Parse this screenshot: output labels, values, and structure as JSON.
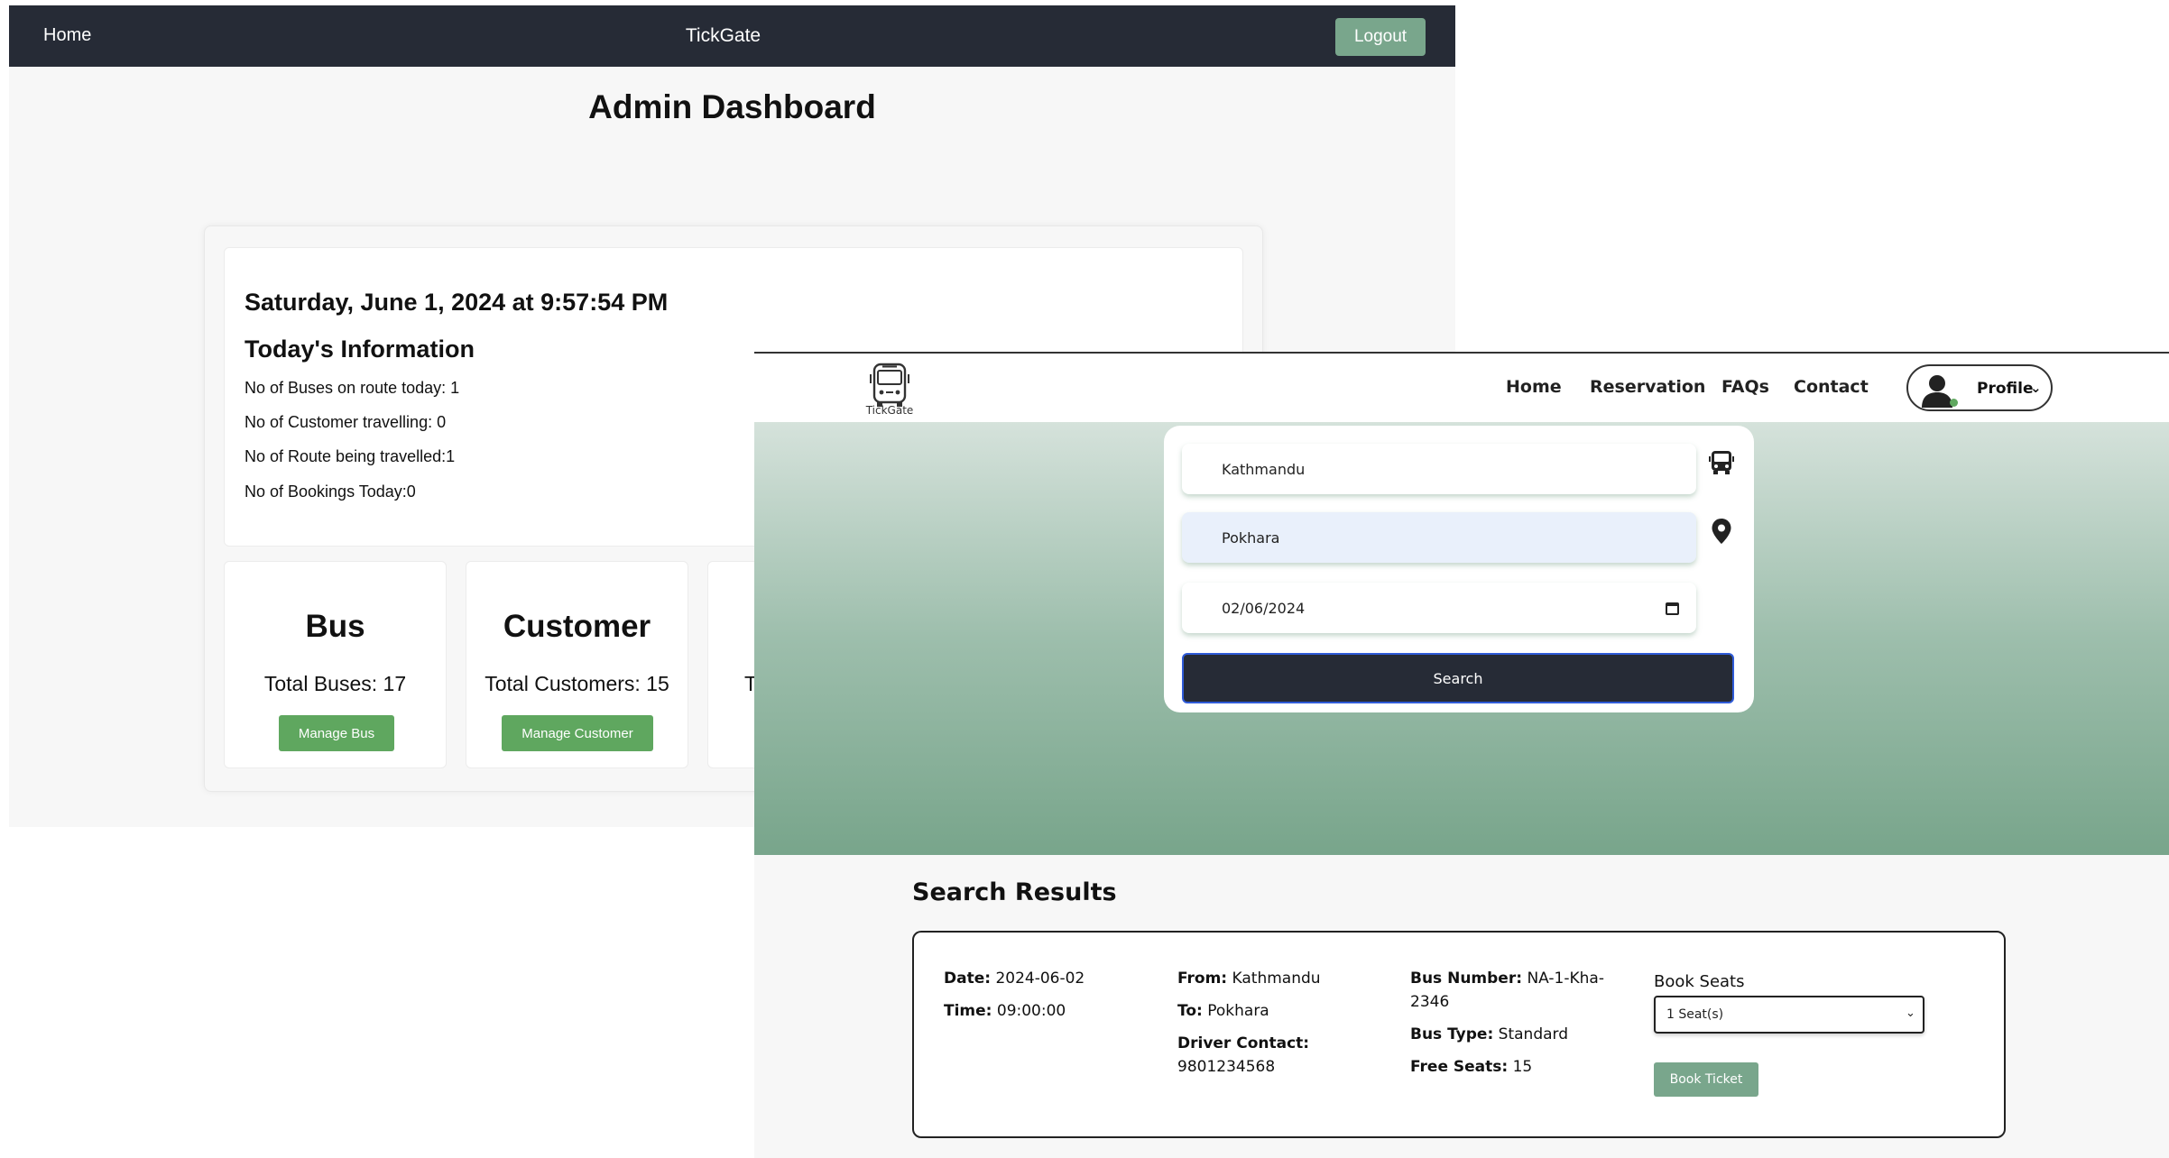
{
  "admin": {
    "nav": {
      "home": "Home",
      "brand": "TickGate",
      "logout": "Logout"
    },
    "title": "Admin Dashboard",
    "datetime": "Saturday, June 1, 2024 at 9:57:54 PM",
    "today_heading": "Today's Information",
    "stats": [
      "No of Buses on route today: 1",
      "No of Customer travelling: 0",
      "No of Route being travelled:1",
      "No of Bookings Today:0"
    ],
    "cards": [
      {
        "title": "Bus",
        "value": "Total Buses: 17",
        "button": "Manage Bus"
      },
      {
        "title": "Customer",
        "value": "Total Customers: 15",
        "button": "Manage Customer"
      },
      {
        "value_fragment": "T"
      }
    ]
  },
  "booking": {
    "logo_text": "TickGate",
    "nav": [
      "Home",
      "Reservation",
      "FAQs",
      "Contact"
    ],
    "profile_label": "Profile",
    "search": {
      "from": "Kathmandu",
      "to": "Pokhara",
      "date": "02/06/2024",
      "button": "Search"
    },
    "results_title": "Search Results",
    "result": {
      "date_label": "Date:",
      "date": "2024-06-02",
      "time_label": "Time:",
      "time": "09:00:00",
      "from_label": "From:",
      "from": "Kathmandu",
      "to_label": "To:",
      "to": "Pokhara",
      "driver_label": "Driver Contact:",
      "driver": "9801234568",
      "bus_number_label": "Bus Number:",
      "bus_number_line1": "NA-1-Kha-",
      "bus_number_line2": "2346",
      "bus_type_label": "Bus Type:",
      "bus_type": "Standard",
      "free_seats_label": "Free Seats:",
      "free_seats": "15",
      "book_seats_label": "Book Seats",
      "seat_option": "1 Seat(s)",
      "book_button": "Book Ticket"
    }
  },
  "icons": [
    "bus-icon",
    "bus-front-icon",
    "location-pin-icon",
    "calendar-icon",
    "user-avatar-icon",
    "chevron-down-icon"
  ]
}
